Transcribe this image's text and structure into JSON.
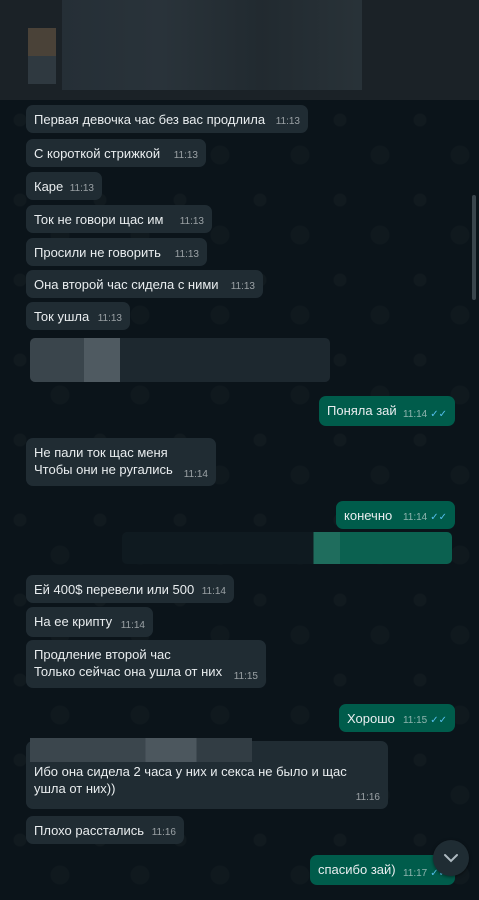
{
  "messages": [
    {
      "text": "Первая девочка час без вас продлила",
      "time": "11:13"
    },
    {
      "text": "С короткой стрижкой",
      "time": "11:13"
    },
    {
      "text": "Каре",
      "time": "11:13"
    },
    {
      "text": "Ток не говори щас им",
      "time": "11:13"
    },
    {
      "text": "Просили не говорить",
      "time": "11:13"
    },
    {
      "text": "Она второй час сидела с ними",
      "time": "11:13"
    },
    {
      "text": "Ток ушла",
      "time": "11:13"
    },
    {
      "text": "Поняла зай",
      "time": "11:14"
    },
    {
      "line1": "Не пали ток щас меня",
      "line2": "Чтобы они не ругались",
      "time": "11:14"
    },
    {
      "text": "конечно",
      "time": "11:14"
    },
    {
      "text": "Ей 400$ перевели или 500",
      "time": "11:14"
    },
    {
      "text": "На ее крипту",
      "time": "11:14"
    },
    {
      "line1": "Продление второй час",
      "line2": "Только сейчас она ушла от них",
      "time": "11:15"
    },
    {
      "text": "Хорошо",
      "time": "11:15"
    },
    {
      "line1": "Ибо она сидела 2 часа у них и секса  не было и щас",
      "line2": "ушла от них))",
      "time": "11:16"
    },
    {
      "text": "Плохо расстались",
      "time": "11:16"
    },
    {
      "text": "спасибо зай)",
      "time": "11:17"
    }
  ],
  "read_ticks": "✓✓",
  "scroll_icon": "chevron-down-icon",
  "colors": {
    "incoming": "#202c33",
    "outgoing": "#005c4b",
    "background": "#0b141a",
    "ticks": "#53bdeb"
  }
}
